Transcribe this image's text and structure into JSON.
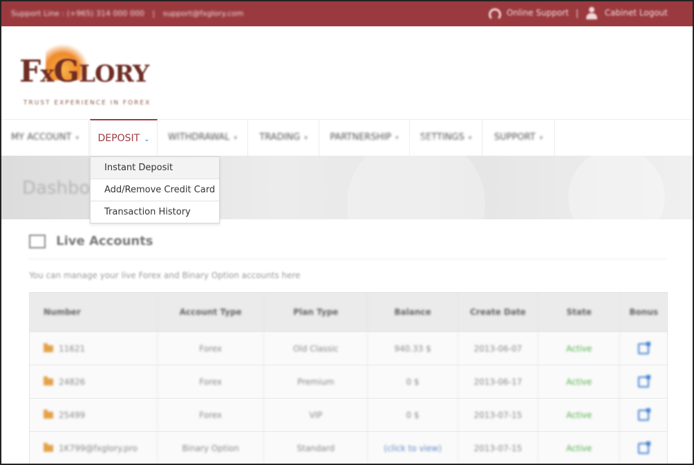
{
  "topbar": {
    "support_line": "Support Line : (+965) 314 000 000",
    "email": "support@fxglory.com",
    "online_support": "Online Support",
    "logout": "Cabinet Logout"
  },
  "logo": {
    "word_big1": "F",
    "word_small1": "x",
    "word_big2": "G",
    "word_small2": "LORY",
    "tagline": "TRUST EXPERIENCE IN FOREX"
  },
  "nav": {
    "items": [
      {
        "label": "MY ACCOUNT"
      },
      {
        "label": "DEPOSIT"
      },
      {
        "label": "WITHDRAWAL"
      },
      {
        "label": "TRADING"
      },
      {
        "label": "PARTNERSHIP"
      },
      {
        "label": "SETTINGS"
      },
      {
        "label": "SUPPORT"
      }
    ]
  },
  "dropdown": {
    "items": [
      {
        "label": "Instant Deposit"
      },
      {
        "label": "Add/Remove Credit Card"
      },
      {
        "label": "Transaction History"
      }
    ]
  },
  "banner": {
    "title": "Dashboard"
  },
  "section": {
    "title": "Live Accounts",
    "description": "You can manage your live Forex and Binary Option accounts here"
  },
  "table": {
    "headers": [
      "Number",
      "Account Type",
      "Plan Type",
      "Balance",
      "Create Date",
      "State",
      "Bonus"
    ],
    "rows": [
      {
        "number": "11621",
        "account_type": "Forex",
        "plan_type": "Old Classic",
        "balance": "940.33 $",
        "create_date": "2013-06-07",
        "state": "Active"
      },
      {
        "number": "24826",
        "account_type": "Forex",
        "plan_type": "Premium",
        "balance": "0 $",
        "create_date": "2013-06-17",
        "state": "Active"
      },
      {
        "number": "25499",
        "account_type": "Forex",
        "plan_type": "VIP",
        "balance": "0 $",
        "create_date": "2013-07-15",
        "state": "Active"
      },
      {
        "number": "1K799@fxglory.pro",
        "account_type": "Binary Option",
        "plan_type": "Standard",
        "balance": "(click to view)",
        "create_date": "2013-07-15",
        "state": "Active"
      }
    ]
  },
  "colors": {
    "brand": "#9b3a3e",
    "active_state": "#52b04a",
    "link": "#3f7fd0"
  }
}
